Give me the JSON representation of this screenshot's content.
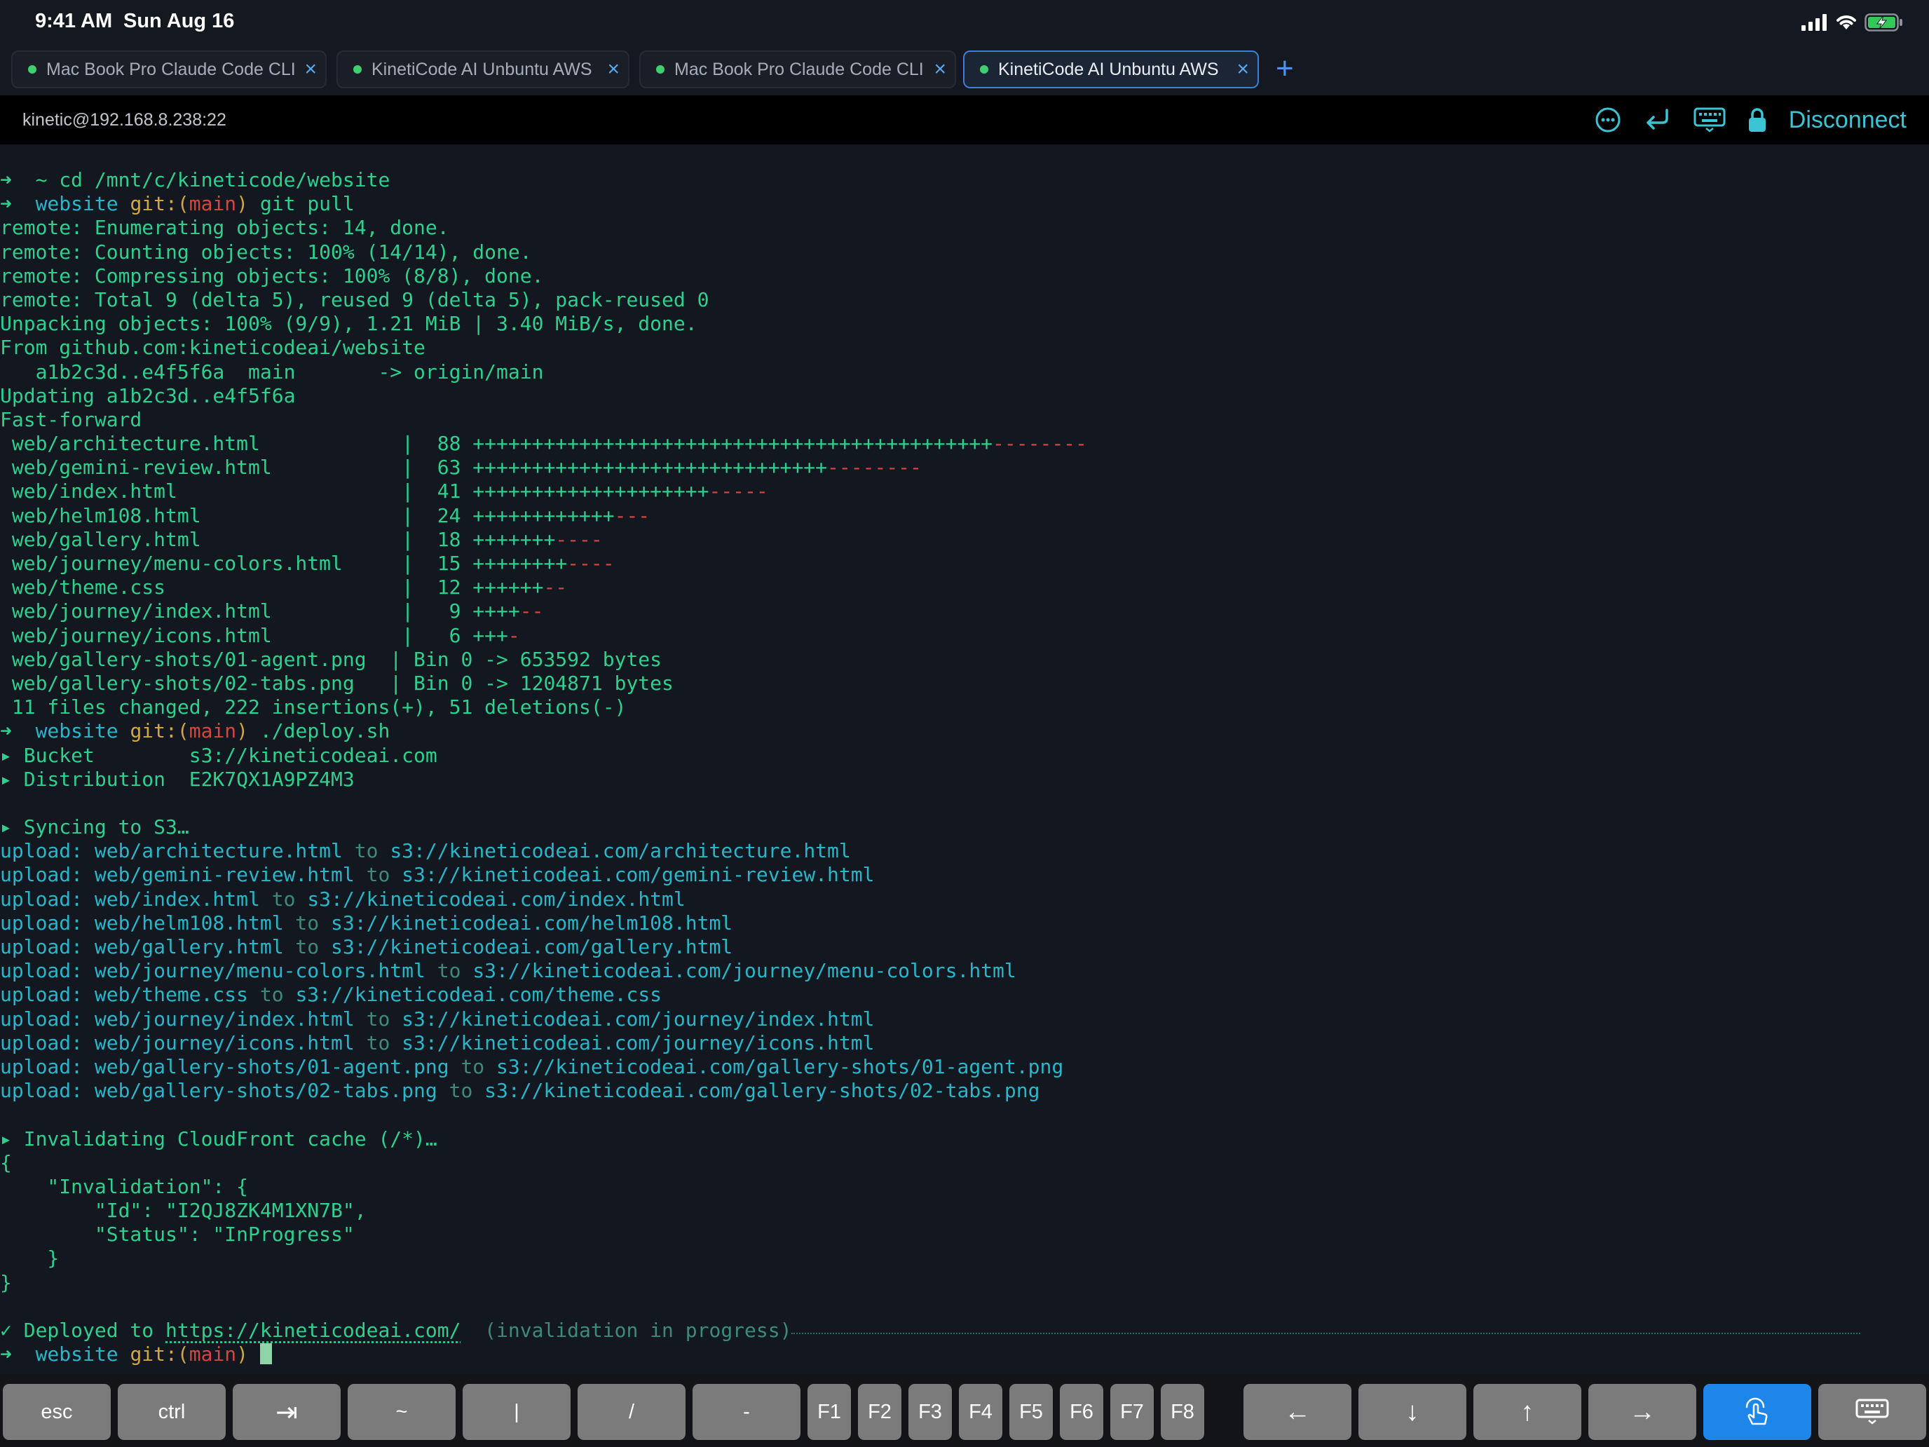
{
  "status_bar": {
    "time": "9:41 AM",
    "date": "Sun Aug 16"
  },
  "tabs": [
    {
      "label": "Mac Book Pro Claude Code CLI",
      "active": false
    },
    {
      "label": "KinetiCode AI Unbuntu AWS",
      "active": false
    },
    {
      "label": "Mac Book Pro Claude Code CLI",
      "active": false
    },
    {
      "label": "KinetiCode AI Unbuntu AWS",
      "active": true
    }
  ],
  "new_tab_label": "+",
  "session": {
    "host": "kinetic@192.168.8.238:22",
    "disconnect_label": "Disconnect"
  },
  "terminal": {
    "l01": {
      "arrow": "➜",
      "rest": "  ~ cd /mnt/c/kineticode/website"
    },
    "l02": {
      "arrow": "➜",
      "dir": "  website ",
      "git": "git:(",
      "branch": "main",
      "close": ")",
      "cmd": " git pull"
    },
    "l03": "remote: Enumerating objects: 14, done.",
    "l04": "remote: Counting objects: 100% (14/14), done.",
    "l05": "remote: Compressing objects: 100% (8/8), done.",
    "l06": "remote: Total 9 (delta 5), reused 9 (delta 5), pack-reused 0",
    "l07": "Unpacking objects: 100% (9/9), 1.21 MiB | 3.40 MiB/s, done.",
    "l08": "From github.com:kineticodeai/website",
    "l09": "   a1b2c3d..e4f5f6a  main       -> origin/main",
    "l10": "Updating a1b2c3d..e4f5f6a",
    "l11": "Fast-forward",
    "stats": [
      {
        "file": " web/architecture.html            |  88 ",
        "plus": "++++++++++++++++++++++++++++++++++++++++++++",
        "minus": "--------"
      },
      {
        "file": " web/gemini-review.html           |  63 ",
        "plus": "++++++++++++++++++++++++++++++",
        "minus": "--------"
      },
      {
        "file": " web/index.html                   |  41 ",
        "plus": "++++++++++++++++++++",
        "minus": "-----"
      },
      {
        "file": " web/helm108.html                 |  24 ",
        "plus": "++++++++++++",
        "minus": "---"
      },
      {
        "file": " web/gallery.html                 |  18 ",
        "plus": "+++++++",
        "minus": "----"
      },
      {
        "file": " web/journey/menu-colors.html     |  15 ",
        "plus": "++++++++",
        "minus": "----"
      },
      {
        "file": " web/theme.css                    |  12 ",
        "plus": "++++++",
        "minus": "--"
      },
      {
        "file": " web/journey/index.html           |   9 ",
        "plus": "++++",
        "minus": "--"
      },
      {
        "file": " web/journey/icons.html           |   6 ",
        "plus": "+++",
        "minus": "-"
      }
    ],
    "bin1": " web/gallery-shots/01-agent.png  | Bin 0 -> 653592 bytes",
    "bin2": " web/gallery-shots/02-tabs.png   | Bin 0 -> 1204871 bytes",
    "summary": " 11 files changed, 222 insertions(+), 51 deletions(-)",
    "deploy_prompt": {
      "arrow": "➜",
      "dir": "  website ",
      "git": "git:(",
      "branch": "main",
      "close": ")",
      "cmd": " ./deploy.sh"
    },
    "bucket": "▸ Bucket        s3://kineticodeai.com",
    "dist": "▸ Distribution  E2K7QX1A9PZ4M3",
    "syncing": "▸ Syncing to S3…",
    "uploads": [
      {
        "prefix": "upload: ",
        "src": "web/architecture.html",
        "to": " to ",
        "dst": "s3://kineticodeai.com/architecture.html"
      },
      {
        "prefix": "upload: ",
        "src": "web/gemini-review.html",
        "to": " to ",
        "dst": "s3://kineticodeai.com/gemini-review.html"
      },
      {
        "prefix": "upload: ",
        "src": "web/index.html",
        "to": " to ",
        "dst": "s3://kineticodeai.com/index.html"
      },
      {
        "prefix": "upload: ",
        "src": "web/helm108.html",
        "to": " to ",
        "dst": "s3://kineticodeai.com/helm108.html"
      },
      {
        "prefix": "upload: ",
        "src": "web/gallery.html",
        "to": " to ",
        "dst": "s3://kineticodeai.com/gallery.html"
      },
      {
        "prefix": "upload: ",
        "src": "web/journey/menu-colors.html",
        "to": " to ",
        "dst": "s3://kineticodeai.com/journey/menu-colors.html"
      },
      {
        "prefix": "upload: ",
        "src": "web/theme.css",
        "to": " to ",
        "dst": "s3://kineticodeai.com/theme.css"
      },
      {
        "prefix": "upload: ",
        "src": "web/journey/index.html",
        "to": " to ",
        "dst": "s3://kineticodeai.com/journey/index.html"
      },
      {
        "prefix": "upload: ",
        "src": "web/journey/icons.html",
        "to": " to ",
        "dst": "s3://kineticodeai.com/journey/icons.html"
      },
      {
        "prefix": "upload: ",
        "src": "web/gallery-shots/01-agent.png",
        "to": " to ",
        "dst": "s3://kineticodeai.com/gallery-shots/01-agent.png"
      },
      {
        "prefix": "upload: ",
        "src": "web/gallery-shots/02-tabs.png",
        "to": " to ",
        "dst": "s3://kineticodeai.com/gallery-shots/02-tabs.png"
      }
    ],
    "invalidating": "▸ Invalidating CloudFront cache (/*)…",
    "json_lines": [
      "{",
      "    \"Invalidation\": {",
      "        \"Id\": \"I2QJ8ZK4M1XN7B\",",
      "        \"Status\": \"InProgress\"",
      "    }",
      "}"
    ],
    "deployed": {
      "check": "✓",
      "text": " Deployed to ",
      "url": "https://kineticodeai.com/",
      "note": "  (invalidation in progress)"
    },
    "final_prompt": {
      "arrow": "➜",
      "dir": "  website ",
      "git": "git:(",
      "branch": "main",
      "close": ") "
    }
  },
  "keys": {
    "esc": "esc",
    "ctrl": "ctrl",
    "tab": "⇥",
    "tilde": "~",
    "pipe": "|",
    "slash": "/",
    "dash": "-",
    "f1": "F1",
    "f2": "F2",
    "f3": "F3",
    "f4": "F4",
    "f5": "F5",
    "f6": "F6",
    "f7": "F7",
    "f8": "F8",
    "left": "←",
    "down": "↓",
    "up": "↑",
    "right": "→"
  },
  "icons": [
    "signal-icon",
    "wifi-icon",
    "battery-charging-icon",
    "more-icon",
    "return-icon",
    "keyboard-icon",
    "lock-icon",
    "touch-icon",
    "hide-keyboard-icon"
  ],
  "colors": {
    "terminal_bg": "#131720",
    "green": "#2fd08e",
    "cyan": "#2ab6c9",
    "yellow": "#d4a73a",
    "red": "#d3473e",
    "accent_blue": "#1e86e8",
    "disconnect": "#3bc4d3"
  }
}
